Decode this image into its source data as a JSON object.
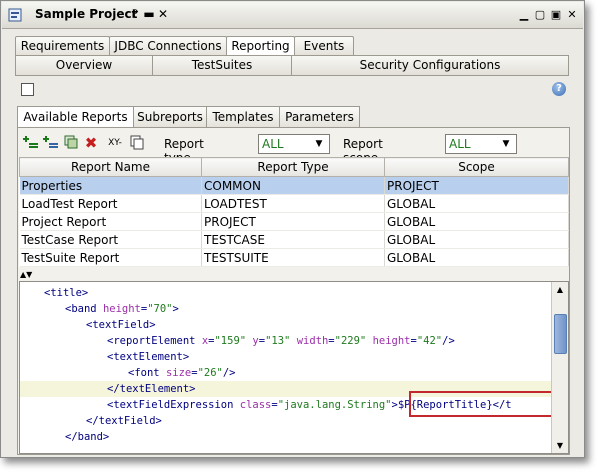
{
  "window": {
    "title": "Sample Project",
    "pin_glyph": "↱",
    "minimize_glyph": "▬",
    "close_glyph": "✕"
  },
  "main_tabs": [
    "Requirements",
    "JDBC Connections",
    "Reporting",
    "Events"
  ],
  "sub_tabs": [
    "Overview",
    "TestSuites",
    "Security Configurations"
  ],
  "report_tabs": [
    "Available Reports",
    "Subreports",
    "Templates",
    "Parameters"
  ],
  "filters": {
    "type_label": "Report type filter:",
    "type_value": "ALL",
    "scope_label": "Report scope filter:",
    "scope_value": "ALL"
  },
  "tool_glyphs": {
    "sort": "XY-"
  },
  "table": {
    "columns": [
      "Report Name",
      "Report Type",
      "Scope"
    ],
    "rows": [
      [
        "Properties",
        "COMMON",
        "PROJECT"
      ],
      [
        "LoadTest Report",
        "LOADTEST",
        "GLOBAL"
      ],
      [
        "Project Report",
        "PROJECT",
        "GLOBAL"
      ],
      [
        "TestCase Report",
        "TESTCASE",
        "GLOBAL"
      ],
      [
        "TestSuite Report",
        "TESTSUITE",
        "GLOBAL"
      ]
    ],
    "selected_row": 0
  },
  "code": {
    "lines": [
      {
        "indent": 1,
        "parts": [
          [
            "tag",
            "<title>"
          ]
        ]
      },
      {
        "indent": 2,
        "parts": [
          [
            "tag",
            "<band "
          ],
          [
            "attr",
            "height"
          ],
          [
            "tag",
            "="
          ],
          [
            "val",
            "\"70\""
          ],
          [
            "tag",
            ">"
          ]
        ]
      },
      {
        "indent": 3,
        "parts": [
          [
            "tag",
            "<textField>"
          ]
        ]
      },
      {
        "indent": 4,
        "parts": [
          [
            "tag",
            "<reportElement "
          ],
          [
            "attr",
            "x"
          ],
          [
            "tag",
            "="
          ],
          [
            "val",
            "\"159\" "
          ],
          [
            "attr",
            "y"
          ],
          [
            "tag",
            "="
          ],
          [
            "val",
            "\"13\" "
          ],
          [
            "attr",
            "width"
          ],
          [
            "tag",
            "="
          ],
          [
            "val",
            "\"229\" "
          ],
          [
            "attr",
            "height"
          ],
          [
            "tag",
            "="
          ],
          [
            "val",
            "\"42\""
          ],
          [
            "tag",
            "/>"
          ]
        ]
      },
      {
        "indent": 4,
        "parts": [
          [
            "tag",
            "<textElement>"
          ]
        ]
      },
      {
        "indent": 5,
        "parts": [
          [
            "tag",
            "<font "
          ],
          [
            "attr",
            "size"
          ],
          [
            "tag",
            "="
          ],
          [
            "val",
            "\"26\""
          ],
          [
            "tag",
            "/>"
          ]
        ]
      },
      {
        "indent": 4,
        "parts": [
          [
            "tag",
            "</textElement>"
          ]
        ],
        "highlight": true
      },
      {
        "indent": 4,
        "parts": [
          [
            "tag",
            "<textFieldExpression "
          ],
          [
            "attr",
            "class"
          ],
          [
            "tag",
            "="
          ],
          [
            "val",
            "\"java.lang.String\""
          ],
          [
            "tag",
            ">$P{ReportTitle}</t"
          ]
        ]
      },
      {
        "indent": 3,
        "parts": [
          [
            "tag",
            "</textField>"
          ]
        ]
      },
      {
        "indent": 2,
        "parts": [
          [
            "tag",
            "</band>"
          ]
        ]
      }
    ]
  },
  "colors": {
    "selection": "#b8d0ee",
    "highlight_line": "#f5f5dc",
    "callout": "#c3282d"
  }
}
